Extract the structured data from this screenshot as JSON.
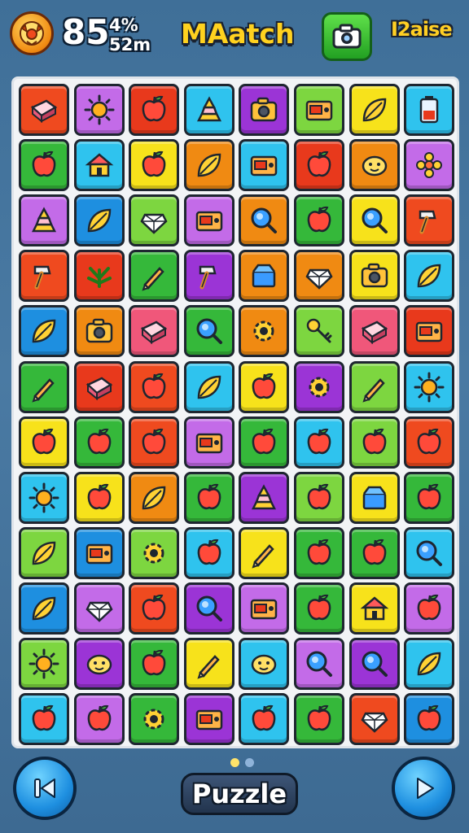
{
  "header": {
    "score_big": "85",
    "score_small_top": "4%",
    "score_small_bottom": "52m",
    "title": "MAatch",
    "right_label": "I2aise"
  },
  "footer": {
    "puzzle_label": "Puzzle",
    "page_dots": [
      "#ffe36a",
      "#8fb3d9"
    ]
  },
  "grid": {
    "rows": [
      [
        [
          "#ef4a1f",
          "tile-icon"
        ],
        [
          "#c36be8",
          "sun-icon"
        ],
        [
          "#e8391c",
          "apple-icon"
        ],
        [
          "#2fc3ee",
          "cake-icon"
        ],
        [
          "#9b34d6",
          "camera-icon"
        ],
        [
          "#7dd640",
          "radio-icon"
        ],
        [
          "#f7e21b",
          "leaf-icon"
        ],
        [
          "#2fc3ee",
          "battery-icon"
        ]
      ],
      [
        [
          "#35b83a",
          "apple-icon"
        ],
        [
          "#2fc3ee",
          "house-icon"
        ],
        [
          "#f7e21b",
          "apple-icon"
        ],
        [
          "#f08a12",
          "leaf-icon"
        ],
        [
          "#2fc3ee",
          "radio-icon"
        ],
        [
          "#e8391c",
          "apple-icon"
        ],
        [
          "#f08a12",
          "face-icon"
        ],
        [
          "#c36be8",
          "flower-icon"
        ]
      ],
      [
        [
          "#c36be8",
          "cake-icon"
        ],
        [
          "#1e8fe0",
          "leaf-icon"
        ],
        [
          "#7dd640",
          "gem-icon"
        ],
        [
          "#c36be8",
          "radio-icon"
        ],
        [
          "#f08a12",
          "magnifier-icon"
        ],
        [
          "#35b83a",
          "apple-icon"
        ],
        [
          "#f7e21b",
          "magnifier-icon"
        ],
        [
          "#ef4a1f",
          "hammer-icon"
        ]
      ],
      [
        [
          "#ef4a1f",
          "hammer-icon"
        ],
        [
          "#e8391c",
          "plant-icon"
        ],
        [
          "#35b83a",
          "pencil-icon"
        ],
        [
          "#9b34d6",
          "hammer-icon"
        ],
        [
          "#f08a12",
          "box-icon"
        ],
        [
          "#f08a12",
          "gem-icon"
        ],
        [
          "#f7e21b",
          "camera-icon"
        ],
        [
          "#2fc3ee",
          "leaf-icon"
        ]
      ],
      [
        [
          "#1e8fe0",
          "leaf-icon"
        ],
        [
          "#f08a12",
          "camera-icon"
        ],
        [
          "#f0577a",
          "tile-icon"
        ],
        [
          "#35b83a",
          "magnifier-icon"
        ],
        [
          "#f08a12",
          "gear-icon"
        ],
        [
          "#7dd640",
          "key-icon"
        ],
        [
          "#f0577a",
          "tile-icon"
        ],
        [
          "#e8391c",
          "radio-icon"
        ]
      ],
      [
        [
          "#35b83a",
          "pencil-icon"
        ],
        [
          "#e8391c",
          "tile-icon"
        ],
        [
          "#ef4a1f",
          "apple-icon"
        ],
        [
          "#2fc3ee",
          "leaf-icon"
        ],
        [
          "#f7e21b",
          "apple-icon"
        ],
        [
          "#9b34d6",
          "gear-icon"
        ],
        [
          "#7dd640",
          "pencil-icon"
        ],
        [
          "#2fc3ee",
          "sun-icon"
        ]
      ],
      [
        [
          "#f7e21b",
          "apple-icon"
        ],
        [
          "#35b83a",
          "apple-icon"
        ],
        [
          "#ef4a1f",
          "apple-icon"
        ],
        [
          "#c36be8",
          "radio-icon"
        ],
        [
          "#35b83a",
          "apple-icon"
        ],
        [
          "#2fc3ee",
          "apple-icon"
        ],
        [
          "#7dd640",
          "apple-icon"
        ],
        [
          "#ef4a1f",
          "apple-icon"
        ]
      ],
      [
        [
          "#2fc3ee",
          "sun-icon"
        ],
        [
          "#f7e21b",
          "apple-icon"
        ],
        [
          "#f08a12",
          "leaf-icon"
        ],
        [
          "#35b83a",
          "apple-icon"
        ],
        [
          "#9b34d6",
          "cake-icon"
        ],
        [
          "#7dd640",
          "apple-icon"
        ],
        [
          "#f7e21b",
          "box-icon"
        ],
        [
          "#35b83a",
          "apple-icon"
        ]
      ],
      [
        [
          "#7dd640",
          "leaf-icon"
        ],
        [
          "#1e8fe0",
          "radio-icon"
        ],
        [
          "#7dd640",
          "gear-icon"
        ],
        [
          "#2fc3ee",
          "apple-icon"
        ],
        [
          "#f7e21b",
          "pencil-icon"
        ],
        [
          "#35b83a",
          "apple-icon"
        ],
        [
          "#35b83a",
          "apple-icon"
        ],
        [
          "#2fc3ee",
          "magnifier-icon"
        ]
      ],
      [
        [
          "#1e8fe0",
          "leaf-icon"
        ],
        [
          "#c36be8",
          "gem-icon"
        ],
        [
          "#ef4a1f",
          "apple-icon"
        ],
        [
          "#9b34d6",
          "magnifier-icon"
        ],
        [
          "#c36be8",
          "radio-icon"
        ],
        [
          "#35b83a",
          "apple-icon"
        ],
        [
          "#f7e21b",
          "house-icon"
        ],
        [
          "#c36be8",
          "apple-icon"
        ]
      ],
      [
        [
          "#7dd640",
          "sun-icon"
        ],
        [
          "#9b34d6",
          "face-icon"
        ],
        [
          "#35b83a",
          "apple-icon"
        ],
        [
          "#f7e21b",
          "pencil-icon"
        ],
        [
          "#2fc3ee",
          "face-icon"
        ],
        [
          "#c36be8",
          "magnifier-icon"
        ],
        [
          "#9b34d6",
          "magnifier-icon"
        ],
        [
          "#2fc3ee",
          "leaf-icon"
        ]
      ],
      [
        [
          "#2fc3ee",
          "apple-icon"
        ],
        [
          "#c36be8",
          "apple-icon"
        ],
        [
          "#35b83a",
          "gear-icon"
        ],
        [
          "#9b34d6",
          "radio-icon"
        ],
        [
          "#2fc3ee",
          "apple-icon"
        ],
        [
          "#35b83a",
          "apple-icon"
        ],
        [
          "#ef4a1f",
          "gem-icon"
        ],
        [
          "#1e8fe0",
          "apple-icon"
        ]
      ]
    ]
  }
}
